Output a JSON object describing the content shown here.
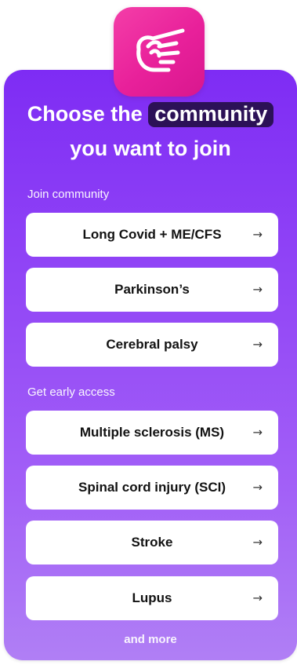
{
  "colors": {
    "card_gradient_top": "#7e2cf4",
    "card_gradient_bottom": "#b07ff5",
    "app_icon_bg": "#e8209a",
    "highlight_bg": "#2c1157",
    "button_bg": "#ffffff",
    "button_text": "#121212"
  },
  "app_icon": {
    "icon": "pointing-hand-icon"
  },
  "headline": {
    "prefix": "Choose the",
    "highlight": "community",
    "line2": "you want to join"
  },
  "sections": {
    "join": {
      "label": "Join community",
      "items": [
        {
          "label": "Long Covid + ME/CFS",
          "arrow": "→"
        },
        {
          "label": "Parkinson’s",
          "arrow": "→"
        },
        {
          "label": "Cerebral palsy",
          "arrow": "→"
        }
      ]
    },
    "early": {
      "label": "Get early access",
      "items": [
        {
          "label": "Multiple sclerosis (MS)",
          "arrow": "→"
        },
        {
          "label": "Spinal cord injury (SCI)",
          "arrow": "→"
        },
        {
          "label": "Stroke",
          "arrow": "→"
        },
        {
          "label": "Lupus",
          "arrow": "→"
        }
      ]
    }
  },
  "footer": {
    "more_text": "and more"
  }
}
